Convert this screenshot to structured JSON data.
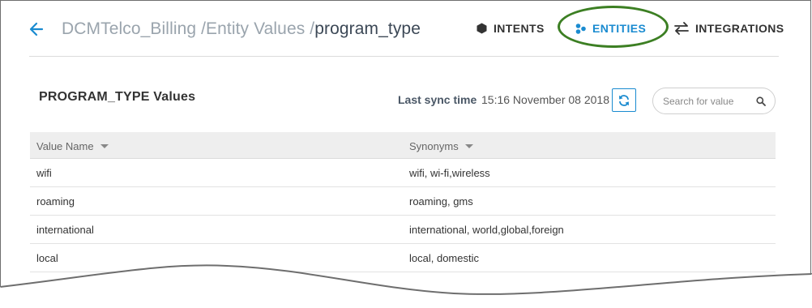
{
  "breadcrumb": {
    "parts": [
      "DCMTelco_Billing /",
      "Entity Values /"
    ],
    "current": "program_type"
  },
  "nav": {
    "intents": "INTENTS",
    "entities": "ENTITIES",
    "integrations": "INTEGRATIONS",
    "active": "entities"
  },
  "highlight_color": "#3c7f23",
  "accent_color": "#1a8bd0",
  "section": {
    "title": "PROGRAM_TYPE Values",
    "sync_label": "Last sync time",
    "sync_time": "15:16 November 08 2018"
  },
  "search": {
    "placeholder": "Search for value",
    "value": ""
  },
  "table": {
    "columns": [
      "Value Name",
      "Synonyms"
    ],
    "rows": [
      {
        "name": "wifi",
        "synonyms": "wifi, wi-fi,wireless"
      },
      {
        "name": "roaming",
        "synonyms": "roaming, gms"
      },
      {
        "name": "international",
        "synonyms": "international, world,global,foreign"
      },
      {
        "name": "local",
        "synonyms": "local, domestic"
      }
    ]
  },
  "icons": {
    "back": "arrow-left-icon",
    "intents": "hexagon-icon",
    "entities": "dots-icon",
    "integrations": "swap-arrows-icon",
    "sync": "refresh-icon",
    "search": "search-icon"
  }
}
